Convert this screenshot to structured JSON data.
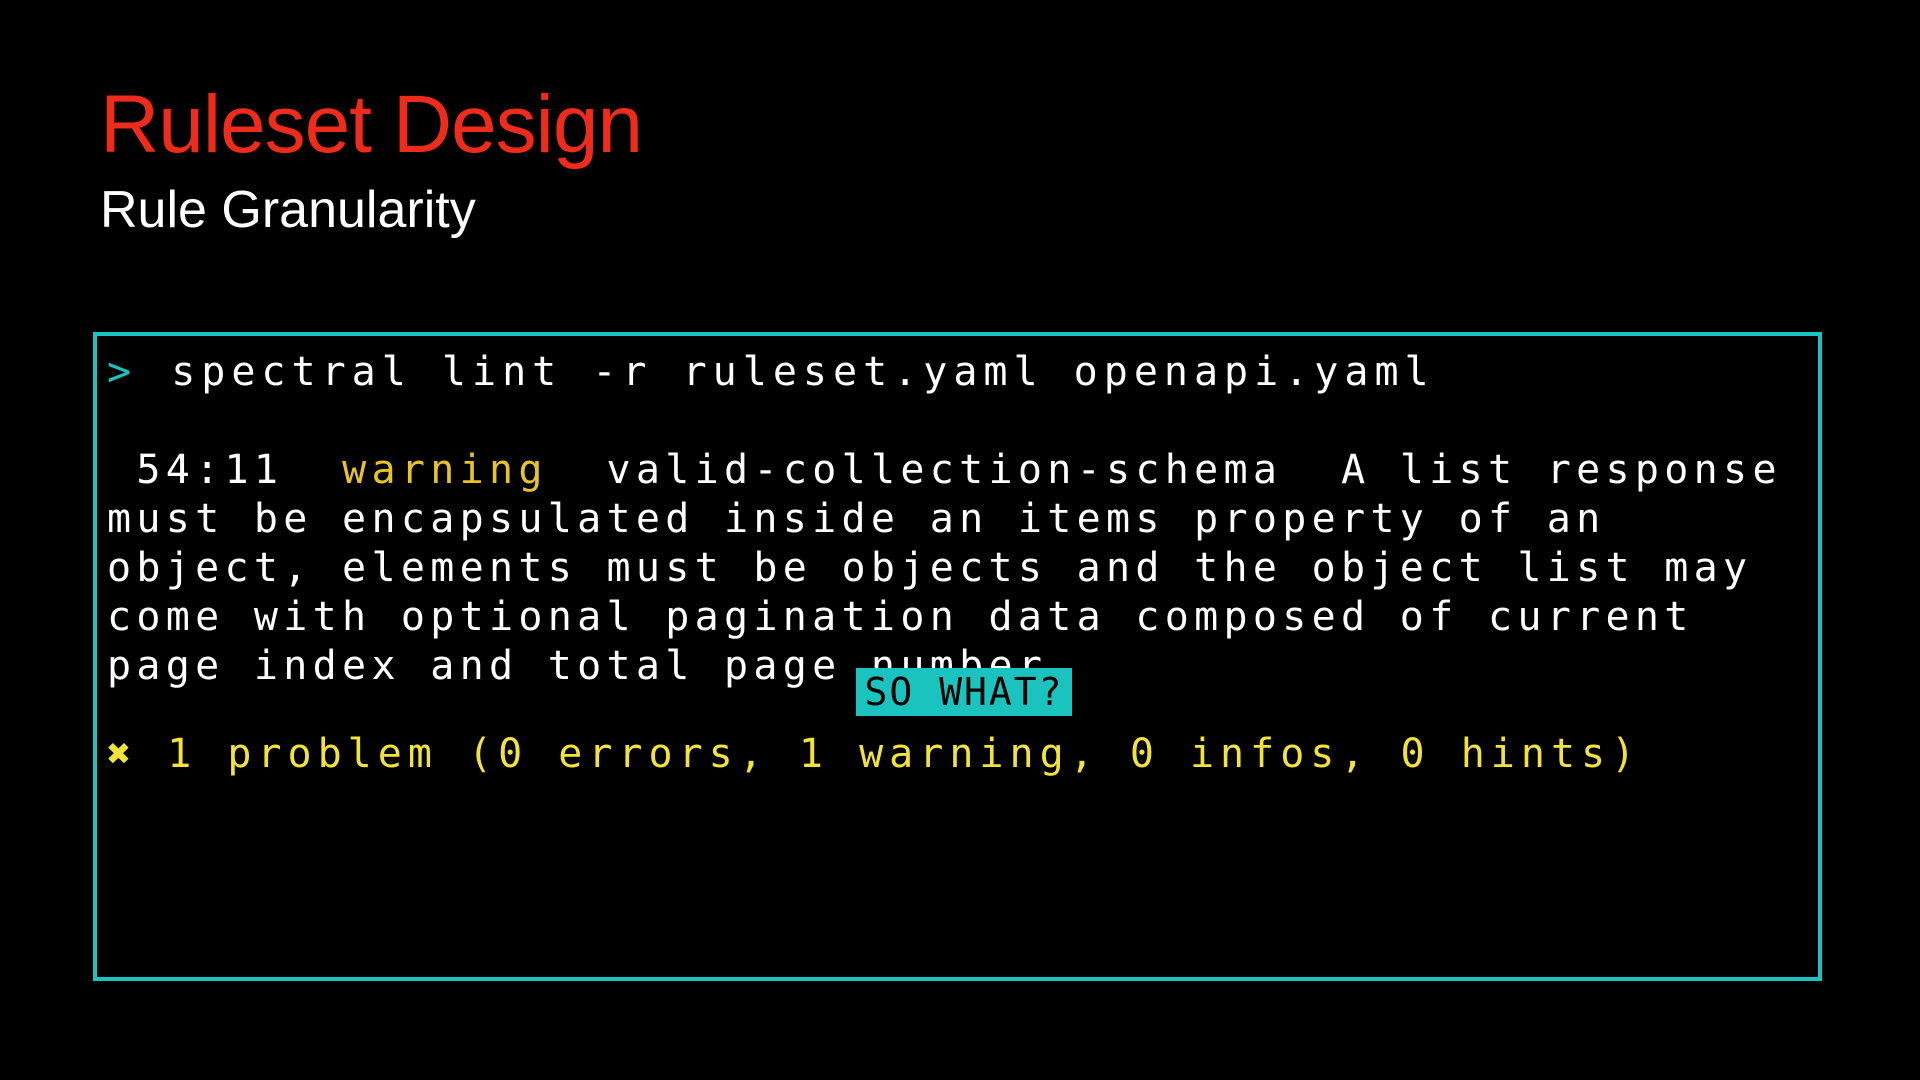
{
  "colors": {
    "background": "#000000",
    "title": "#ef2b1b",
    "subtitle": "#ffffff",
    "terminal_border": "#1ac3bd",
    "terminal_text": "#ffffff",
    "prompt": "#1ac3bd",
    "warning": "#e7c32a",
    "summary": "#f2e33a",
    "callout_bg": "#1ac3bd",
    "callout_text": "#000000"
  },
  "slide": {
    "title": "Ruleset Design",
    "subtitle": "Rule Granularity"
  },
  "terminal": {
    "prompt_symbol": ">",
    "command": "spectral lint -r ruleset.yaml openapi.yaml",
    "result": {
      "location": "54:11",
      "severity": "warning",
      "rule": "valid-collection-schema",
      "message": "A list response must be encapsulated inside an items property of an object, elements must be objects and the object list may come with optional pagination data composed of current page index and total page number"
    },
    "callout": "SO WHAT?",
    "summary_icon": "✖",
    "summary": "1 problem (0 errors, 1 warning, 0 infos, 0 hints)"
  }
}
